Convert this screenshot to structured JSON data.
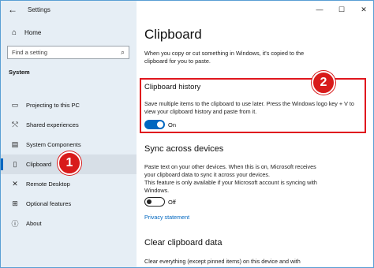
{
  "window": {
    "title": "Settings"
  },
  "controls": {
    "back": "←",
    "minimize": "—",
    "maximize": "☐",
    "close": "✕"
  },
  "sidebar": {
    "home": {
      "label": "Home",
      "icon": "home-icon"
    },
    "search": {
      "placeholder": "Find a setting"
    },
    "section": "System",
    "items": [
      {
        "label": "Projecting to this PC",
        "icon": "projector-icon"
      },
      {
        "label": "Shared experiences",
        "icon": "shared-icon"
      },
      {
        "label": "System Components",
        "icon": "components-icon"
      },
      {
        "label": "Clipboard",
        "icon": "clipboard-icon",
        "active": true
      },
      {
        "label": "Remote Desktop",
        "icon": "remote-desktop-icon"
      },
      {
        "label": "Optional features",
        "icon": "optional-features-icon"
      },
      {
        "label": "About",
        "icon": "info-icon"
      }
    ]
  },
  "badges": {
    "one": "1",
    "two": "2",
    "color": "#d81b1b"
  },
  "main": {
    "title": "Clipboard",
    "intro": "When you copy or cut something in Windows, it's copied to the clipboard for you to paste.",
    "history": {
      "title": "Clipboard history",
      "description": "Save multiple items to the clipboard to use later. Press the Windows logo key + V to view your clipboard history and paste from it.",
      "state_label": "On",
      "on": true
    },
    "sync": {
      "title": "Sync across devices",
      "description": "Paste text on your other devices. When this is on, Microsoft receives your clipboard data to sync it across your devices.",
      "note": "This feature is only available if your Microsoft account is syncing with Windows.",
      "state_label": "Off",
      "on": false,
      "privacy_link": "Privacy statement"
    },
    "clear": {
      "title": "Clear clipboard data",
      "description": "Clear everything (except pinned items) on this device and with"
    }
  },
  "colors": {
    "accent": "#0067c0",
    "highlight": "#e0161e",
    "sidebar_bg": "#e6eef5"
  }
}
